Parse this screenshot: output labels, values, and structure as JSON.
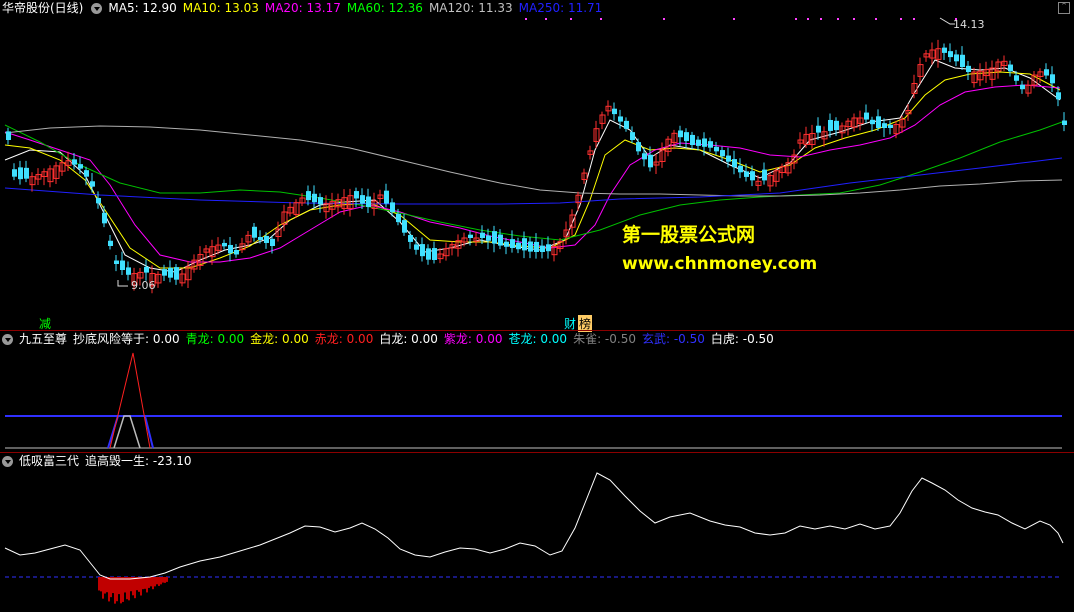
{
  "main": {
    "title": "华帝股份(日线)",
    "ma": [
      {
        "label": "MA5: 12.90",
        "color": "#ffffff"
      },
      {
        "label": "MA10: 13.03",
        "color": "#ffff00"
      },
      {
        "label": "MA20: 13.17",
        "color": "#ff00ff"
      },
      {
        "label": "MA60: 12.36",
        "color": "#00ff00"
      },
      {
        "label": "MA120: 11.33",
        "color": "#c0c0c0"
      },
      {
        "label": "MA250: 11.71",
        "color": "#0000ff"
      }
    ],
    "high_label": "14.13",
    "low_label": "9.06",
    "watermark_cn": "第一股票公式网",
    "watermark_url": "www.chnmoney.com",
    "marker_jian": "减",
    "marker_cai": "财",
    "marker_bang": "榜"
  },
  "ind1": {
    "title": "九五至尊",
    "fields": [
      {
        "label": "抄底风险等于: 0.00",
        "color": "#ffffff"
      },
      {
        "label": "青龙: 0.00",
        "color": "#00ff00"
      },
      {
        "label": "金龙: 0.00",
        "color": "#ffff00"
      },
      {
        "label": "赤龙: 0.00",
        "color": "#ff2020"
      },
      {
        "label": "白龙: 0.00",
        "color": "#ffffff"
      },
      {
        "label": "紫龙: 0.00",
        "color": "#ff00ff"
      },
      {
        "label": "苍龙: 0.00",
        "color": "#00ffff"
      },
      {
        "label": "朱雀: -0.50",
        "color": "#808080"
      },
      {
        "label": "玄武: -0.50",
        "color": "#3030ff"
      },
      {
        "label": "白虎: -0.50",
        "color": "#ffffff"
      }
    ]
  },
  "ind2": {
    "title": "低吸富三代",
    "fields": [
      {
        "label": "追高毁一生: -23.10",
        "color": "#ffffff"
      }
    ]
  }
}
